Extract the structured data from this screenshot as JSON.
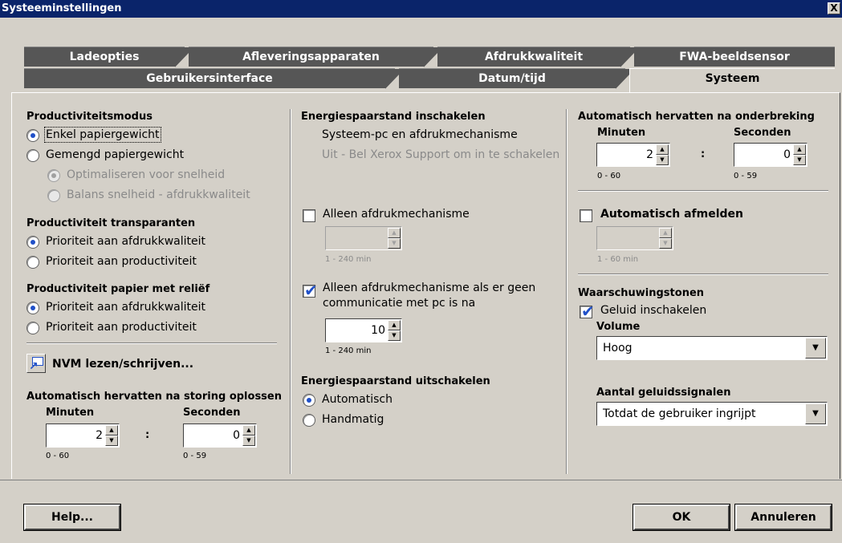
{
  "window": {
    "title": "Systeeminstellingen",
    "close_label": "X"
  },
  "tabs_row1": [
    {
      "label": "Ladeopties"
    },
    {
      "label": "Afleveringsapparaten"
    },
    {
      "label": "Afdrukkwaliteit"
    },
    {
      "label": "FWA-beeldsensor"
    }
  ],
  "tabs_row2": [
    {
      "label": "Gebruikersinterface"
    },
    {
      "label": "Datum/tijd"
    },
    {
      "label": "Systeem",
      "active": true
    }
  ],
  "col1": {
    "prod_mode": {
      "heading": "Productiviteitsmodus",
      "options": [
        {
          "label": "Enkel papiergewicht",
          "selected": true
        },
        {
          "label": "Gemengd papiergewicht",
          "selected": false
        }
      ],
      "sub_options": [
        {
          "label": "Optimaliseren voor snelheid",
          "selected": true
        },
        {
          "label": "Balans snelheid - afdrukkwaliteit",
          "selected": false
        }
      ]
    },
    "transparants": {
      "heading": "Productiviteit transparanten",
      "options": [
        {
          "label": "Prioriteit aan afdrukkwaliteit",
          "selected": true
        },
        {
          "label": "Prioriteit aan productiviteit",
          "selected": false
        }
      ]
    },
    "relief": {
      "heading": "Productiviteit papier met reliëf",
      "options": [
        {
          "label": "Prioriteit aan afdrukkwaliteit",
          "selected": true
        },
        {
          "label": "Prioriteit aan productiviteit",
          "selected": false
        }
      ]
    },
    "nvm_label": "NVM lezen/schrijven...",
    "auto_resume": {
      "heading": "Automatisch hervatten na storing oplossen",
      "minutes_label": "Minuten",
      "seconds_label": "Seconden",
      "minutes_value": "2",
      "seconds_value": "0",
      "separator": ":",
      "minutes_range": "0 - 60",
      "seconds_range": "0 - 59"
    }
  },
  "col2": {
    "energy_on": {
      "heading": "Energiespaarstand inschakelen",
      "line1": "Systeem-pc en afdrukmechanisme",
      "line2": "Uit - Bel Xerox Support om in te schakelen"
    },
    "print_engine_only": {
      "label": "Alleen afdrukmechanisme",
      "checked": false,
      "value": "",
      "range": "1 - 240 min"
    },
    "no_comm": {
      "label_line1": "Alleen afdrukmechanisme als er geen",
      "label_line2": "communicatie met pc is na",
      "checked": true,
      "value": "10",
      "range": "1 - 240 min"
    },
    "energy_off": {
      "heading": "Energiespaarstand uitschakelen",
      "options": [
        {
          "label": "Automatisch",
          "selected": true
        },
        {
          "label": "Handmatig",
          "selected": false
        }
      ]
    }
  },
  "col3": {
    "auto_resume_interrupt": {
      "heading": "Automatisch hervatten na onderbreking",
      "minutes_label": "Minuten",
      "seconds_label": "Seconden",
      "minutes_value": "2",
      "seconds_value": "0",
      "separator": ":",
      "minutes_range": "0 - 60",
      "seconds_range": "0 - 59"
    },
    "auto_logout": {
      "label": "Automatisch afmelden",
      "checked": false,
      "value": "",
      "range": "1 - 60 min"
    },
    "warning_tones": {
      "heading": "Waarschuwingstonen",
      "enable_label": "Geluid inschakelen",
      "enabled": true,
      "volume_label": "Volume",
      "volume_value": "Hoog",
      "signals_label": "Aantal geluidssignalen",
      "signals_value": "Totdat de gebruiker ingrijpt"
    }
  },
  "footer": {
    "help_label": "Help...",
    "ok_label": "OK",
    "cancel_label": "Annuleren"
  }
}
